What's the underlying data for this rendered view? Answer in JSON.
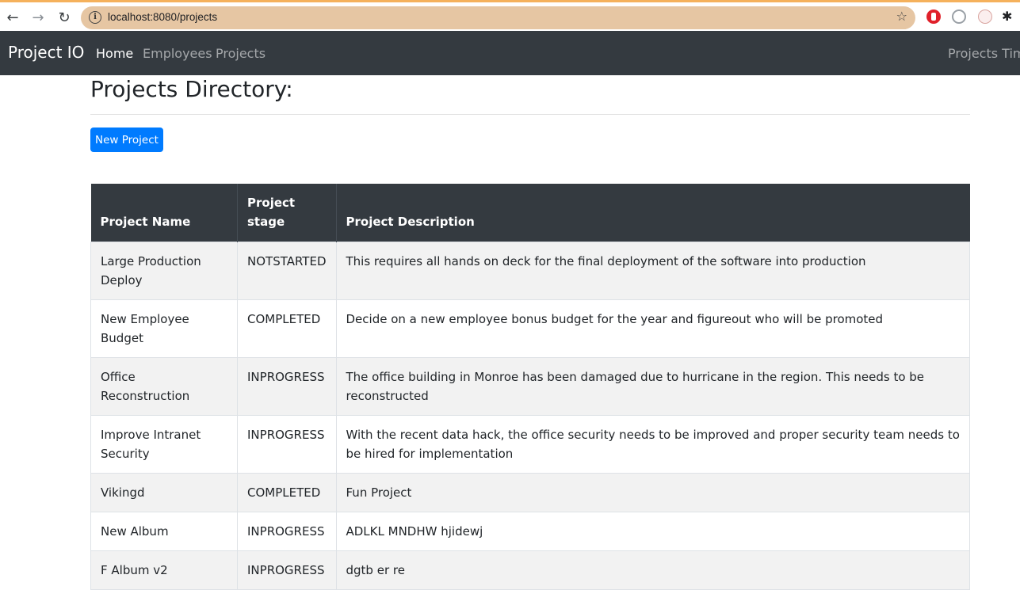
{
  "browser": {
    "url": "localhost:8080/projects"
  },
  "navbar": {
    "brand": "Project IO",
    "links": [
      "Home",
      "Employees",
      "Projects"
    ],
    "right_link": "Projects Time"
  },
  "page": {
    "title": "Projects Directory:",
    "new_button": "New Project"
  },
  "table": {
    "headers": [
      "Project Name",
      "Project stage",
      "Project Description"
    ],
    "rows": [
      [
        "Large Production Deploy",
        "NOTSTARTED",
        "This requires all hands on deck for the final deployment of the software into production"
      ],
      [
        "New Employee Budget",
        "COMPLETED",
        "Decide on a new employee bonus budget for the year and figureout who will be promoted"
      ],
      [
        "Office Reconstruction",
        "INPROGRESS",
        "The office building in Monroe has been damaged due to hurricane in the region. This needs to be reconstructed"
      ],
      [
        "Improve Intranet Security",
        "INPROGRESS",
        "With the recent data hack, the office security needs to be improved and proper security team needs to be hired for implementation"
      ],
      [
        "Vikingd",
        "COMPLETED",
        "Fun Project"
      ],
      [
        "New Album",
        "INPROGRESS",
        "ADLKL MNDHW hjidewj"
      ],
      [
        "F Album v2",
        "INPROGRESS",
        "dgtb er re"
      ]
    ]
  }
}
